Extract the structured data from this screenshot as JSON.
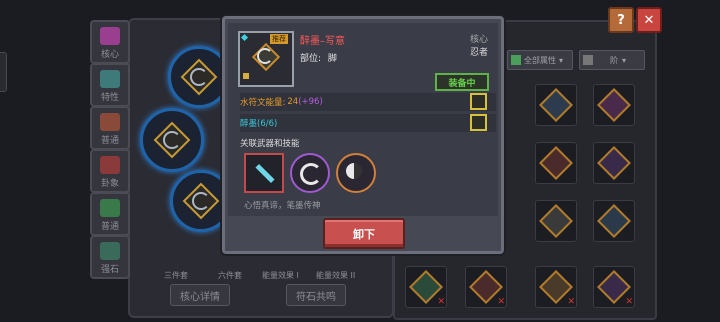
{
  "sidebar": {
    "tabs": [
      {
        "label": "核心",
        "color": "#9a3f8f"
      },
      {
        "label": "特性",
        "color": "#3e7a7a"
      },
      {
        "label": "普通",
        "color": "#8a4a3a"
      },
      {
        "label": "卦象",
        "color": "#8a3a3a"
      },
      {
        "label": "普通",
        "color": "#3a7a4a"
      },
      {
        "label": "强石",
        "color": "#3a6a5a"
      }
    ]
  },
  "set_labels": [
    "三件套",
    "六件套",
    "能量效果 I",
    "能量效果 II"
  ],
  "bottom_buttons": {
    "core_detail": "核心详情",
    "rune_resonance": "符石共鸣"
  },
  "filters": {
    "all_attributes": "全部属性",
    "sort": "阶"
  },
  "popup": {
    "recommend_badge": "推荐",
    "item_name": "醉墨–写意",
    "slot_label": "部位:",
    "slot_value": "脚",
    "category": "核心",
    "class": "忍者",
    "equipped_badge": "装备中",
    "energy_label": "水符文能量:",
    "energy_value": "24",
    "energy_bonus": "(+96)",
    "set_label": "醉墨(6/6)",
    "linked_label": "关联武器和技能",
    "description": "心悟真谛，笔墨传神",
    "unequip_button": "卸下"
  },
  "top_buttons": {
    "help": "?",
    "close": "✕"
  }
}
